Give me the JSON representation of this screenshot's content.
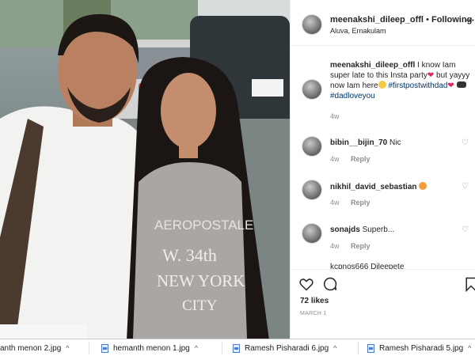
{
  "post": {
    "username": "meenakshi_dileep_offl",
    "separator": "•",
    "follow_label": "Following",
    "location": "Aluva, Ernakulam",
    "more_icon": "more-icon",
    "caption": {
      "username": "meenakshi_dileep_offl",
      "text_1": "I know Iam super late to this Insta party",
      "text_2": "but yayyy now Iam here",
      "hashtag_1": "#firstpostwithdad",
      "hashtag_2": "#dadloveyou"
    },
    "time": "4w"
  },
  "comments": [
    {
      "username": "bibin__bijin_70",
      "text": "Nic",
      "time": "4w",
      "reply": "Reply"
    },
    {
      "username": "nikhil_david_sebastian",
      "text": "",
      "time": "4w",
      "reply": "Reply"
    },
    {
      "username": "sonajds",
      "text": "Superb...",
      "time": "4w",
      "reply": "Reply"
    }
  ],
  "partial_comment": "kcpnos666  Dileepete",
  "likes": "72 likes",
  "date": "MARCH 1",
  "photo_text": {
    "line1": "W. 34th",
    "line2": "NEW YORK",
    "line3": "CITY",
    "brand": "AEROPOSTALE"
  },
  "downloads": [
    {
      "name": "anth menon 2.jpg"
    },
    {
      "name": "hemanth menon 1.jpg"
    },
    {
      "name": "Ramesh Pisharadi 6.jpg"
    },
    {
      "name": "Ramesh Pisharadi 5.jpg"
    }
  ],
  "colors": {
    "link": "#00376b",
    "meta": "#8e8e8e",
    "text": "#262626"
  }
}
